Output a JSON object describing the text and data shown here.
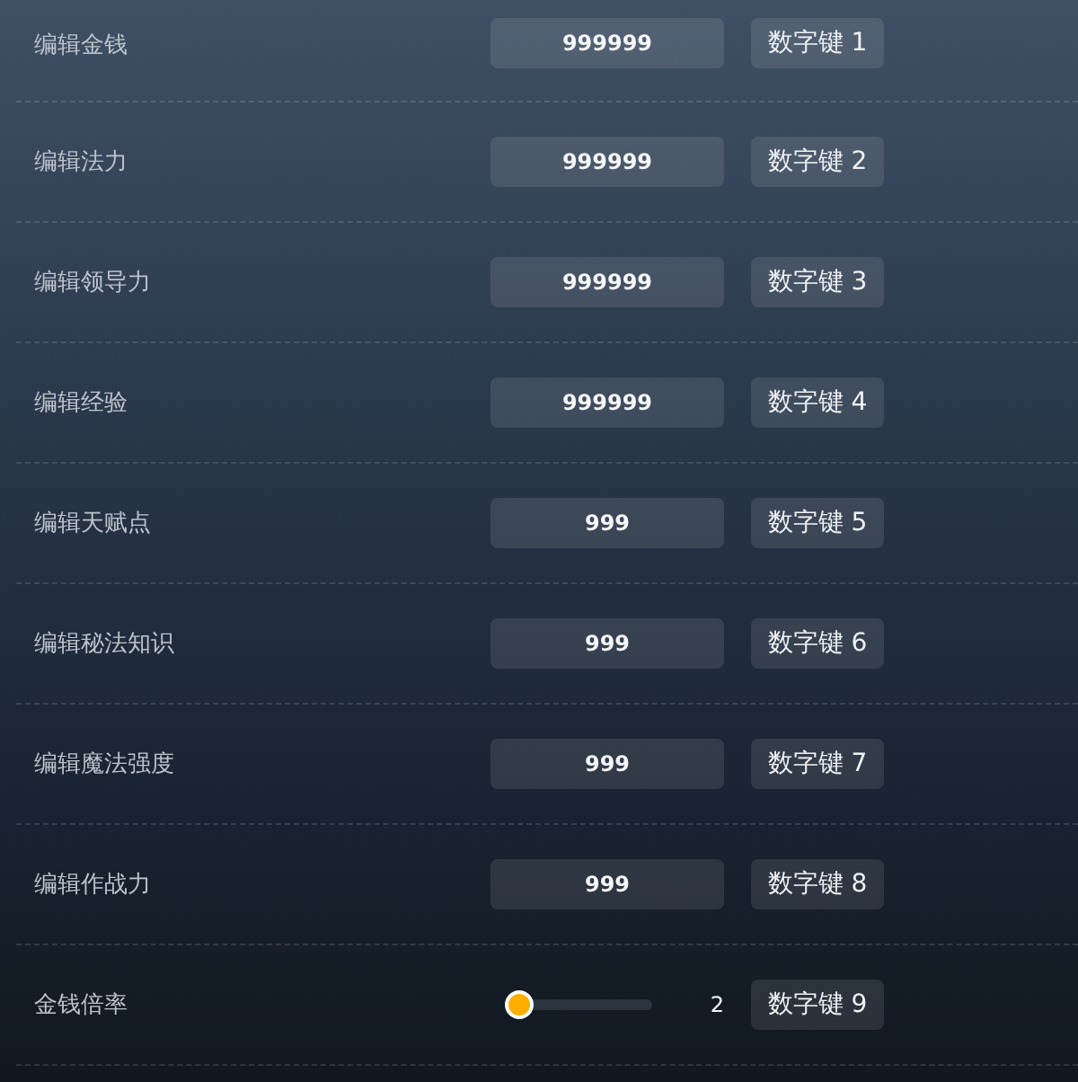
{
  "rows": [
    {
      "kind": "input",
      "label": "编辑金钱",
      "value": "999999",
      "hotkey": "数字键 1"
    },
    {
      "kind": "input",
      "label": "编辑法力",
      "value": "999999",
      "hotkey": "数字键 2"
    },
    {
      "kind": "input",
      "label": "编辑领导力",
      "value": "999999",
      "hotkey": "数字键 3"
    },
    {
      "kind": "input",
      "label": "编辑经验",
      "value": "999999",
      "hotkey": "数字键 4"
    },
    {
      "kind": "input",
      "label": "编辑天赋点",
      "value": "999",
      "hotkey": "数字键 5"
    },
    {
      "kind": "input",
      "label": "编辑秘法知识",
      "value": "999",
      "hotkey": "数字键 6"
    },
    {
      "kind": "input",
      "label": "编辑魔法强度",
      "value": "999",
      "hotkey": "数字键 7"
    },
    {
      "kind": "input",
      "label": "编辑作战力",
      "value": "999",
      "hotkey": "数字键 8"
    },
    {
      "kind": "slider",
      "label": "金钱倍率",
      "level": 0,
      "reading": "2",
      "hotkey": "数字键 9"
    }
  ]
}
